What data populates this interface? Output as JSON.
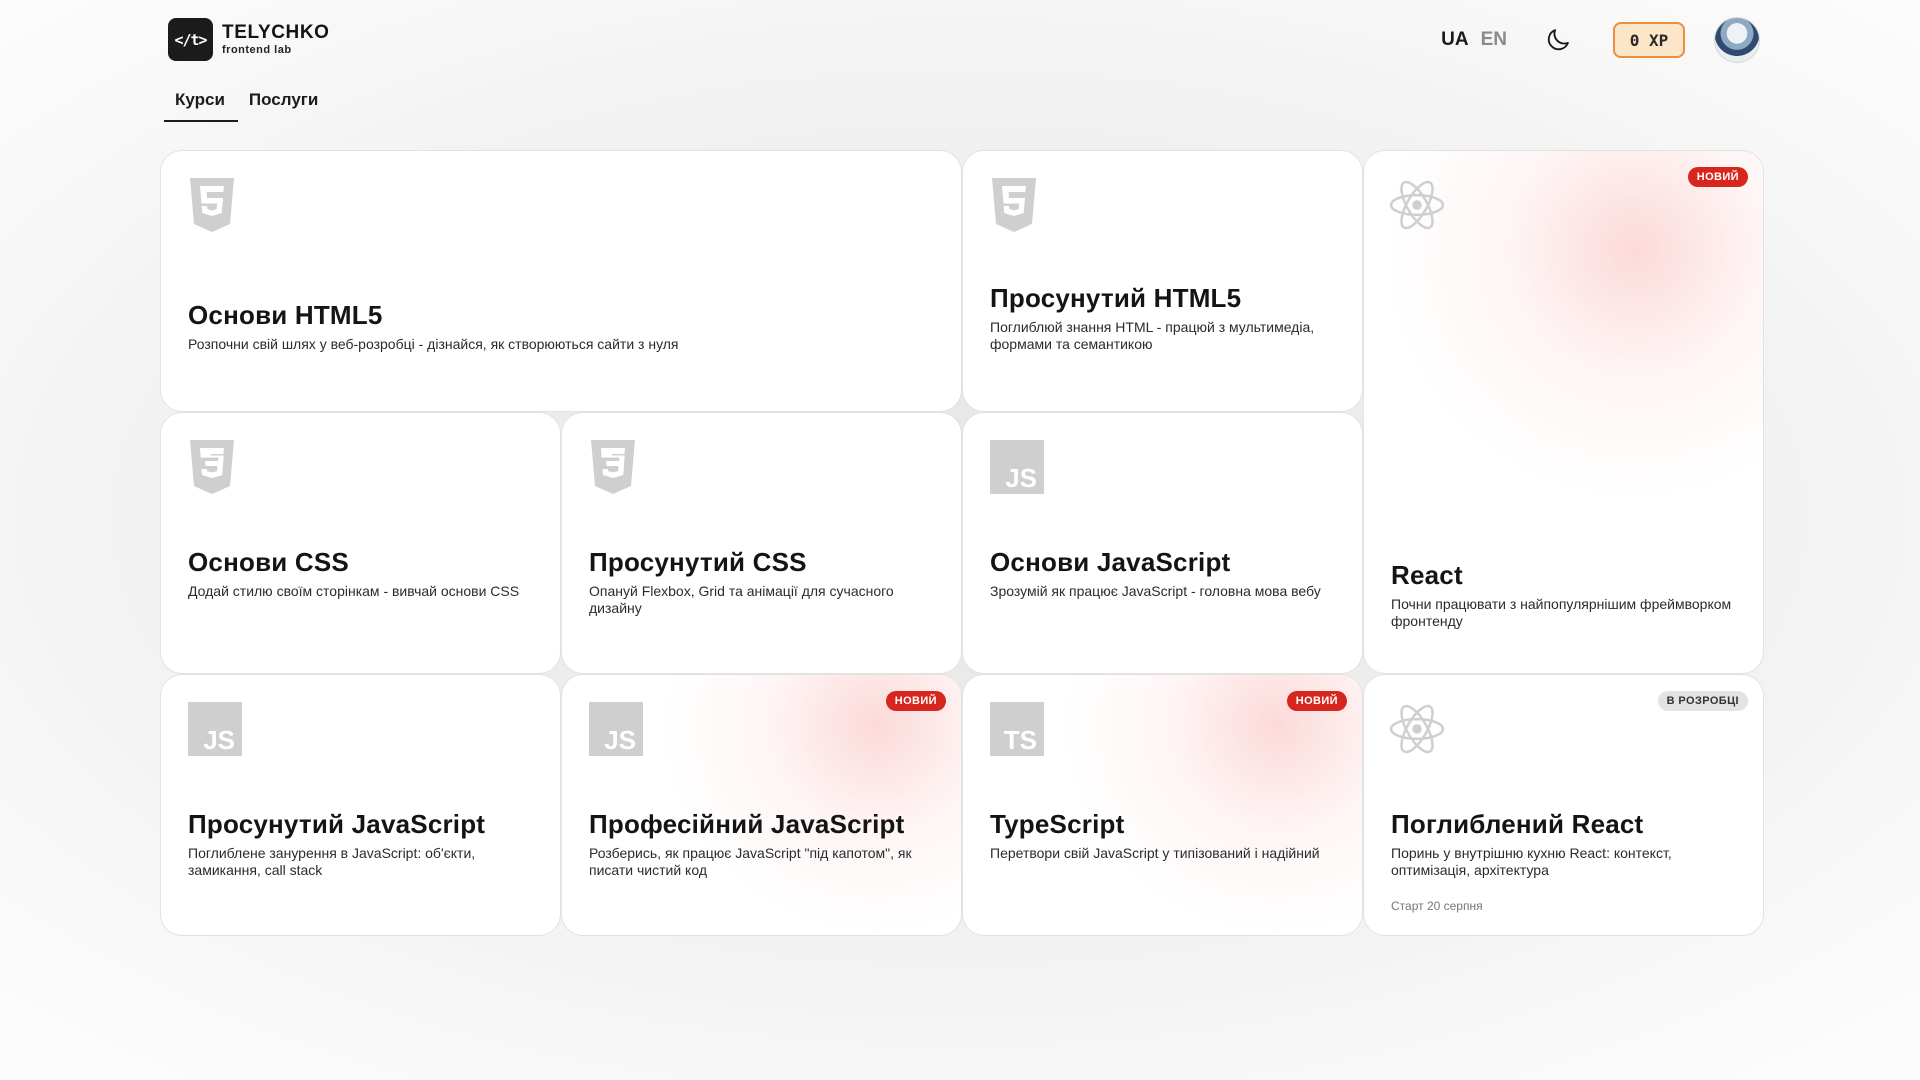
{
  "brand": {
    "logo_mark": "</t>",
    "name": "TELYCHKO",
    "subtitle": "frontend lab"
  },
  "header": {
    "languages": [
      {
        "label": "UA",
        "active": true
      },
      {
        "label": "EN",
        "active": false
      }
    ],
    "theme_icon": "moon-icon",
    "xp": "0 XP",
    "xp_colors": {
      "border": "#e8913a",
      "background": "#fde6c8"
    }
  },
  "tabs": [
    {
      "label": "Курси",
      "active": true
    },
    {
      "label": "Послуги",
      "active": false
    }
  ],
  "badge_colors": {
    "new": "#d7261e",
    "in_dev": "#e3e3e3"
  },
  "cards": {
    "html5": {
      "icon": "html5-icon",
      "title": "Основи HTML5",
      "description": "Розпочни свій шлях у веб-розробці - дізнайся, як створюються сайти з нуля"
    },
    "adv_html5": {
      "icon": "html5-icon",
      "title": "Просунутий HTML5",
      "description": "Поглиблюй знання HTML - працюй з мультимедіа, формами та семантикою"
    },
    "react": {
      "icon": "react-icon",
      "badge": "НОВИЙ",
      "title": "React",
      "description": "Почни працювати з найпопулярнішим фреймворком фронтенду"
    },
    "css": {
      "icon": "css3-icon",
      "title": "Основи CSS",
      "description": "Додай стилю своїм сторінкам - вивчай основи CSS"
    },
    "adv_css": {
      "icon": "css3-icon",
      "title": "Просунутий CSS",
      "description": "Опануй Flexbox, Grid та анімації для сучасного дизайну"
    },
    "js": {
      "icon": "js-icon",
      "icon_text": "JS",
      "title": "Основи JavaScript",
      "description": "Зрозумій як працює JavaScript - головна мова вебу"
    },
    "adv_js": {
      "icon": "js-icon",
      "icon_text": "JS",
      "title": "Просунутий JavaScript",
      "description": "Поглиблене занурення в JavaScript: об'єкти, замикання, call stack"
    },
    "pro_js": {
      "icon": "js-icon",
      "icon_text": "JS",
      "badge": "НОВИЙ",
      "title": "Професійний JavaScript",
      "description": "Розберись, як працює JavaScript \"під капотом\", як писати чистий код"
    },
    "ts": {
      "icon": "ts-icon",
      "icon_text": "TS",
      "badge": "НОВИЙ",
      "title": "TypeScript",
      "description": "Перетвори свій JavaScript у типізований і надійний"
    },
    "deep_react": {
      "icon": "react-icon",
      "badge": "В РОЗРОБЦІ",
      "title": "Поглиблений React",
      "description": "Поринь у внутрішню кухню React:  контекст, оптимізація, архітектура",
      "start": "Старт 20 серпня"
    }
  }
}
